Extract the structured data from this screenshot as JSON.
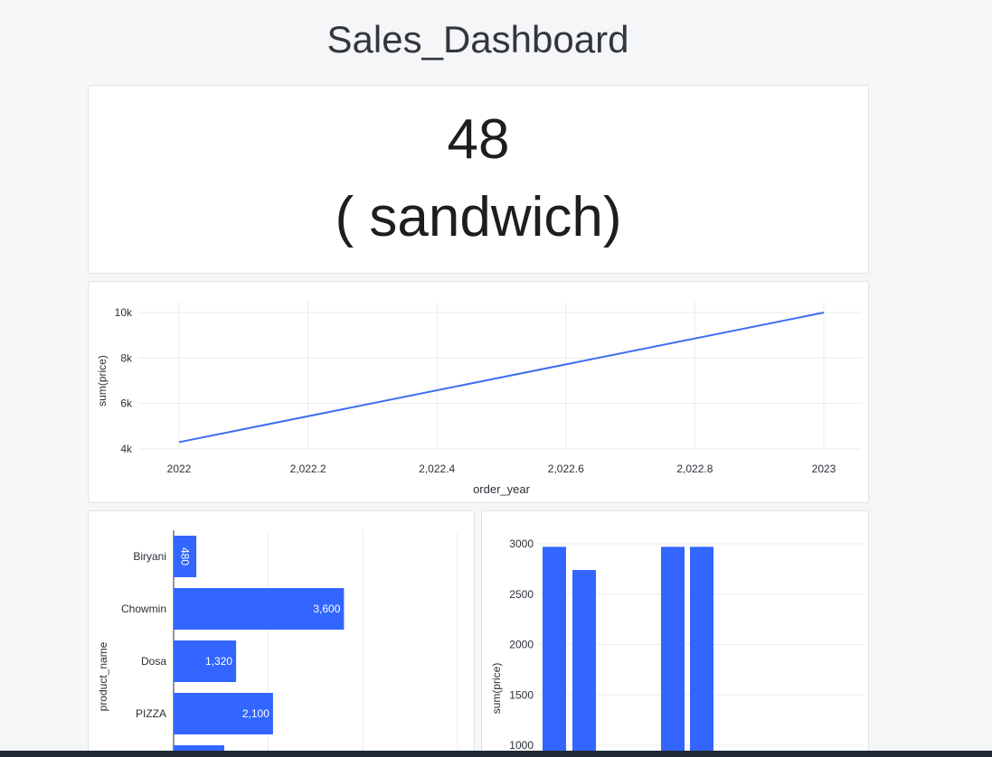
{
  "page": {
    "title": "Sales_Dashboard"
  },
  "kpi": {
    "value": "48",
    "label": "( sandwich)"
  },
  "colors": {
    "bar": "#3366ff",
    "line": "#3d6ef0",
    "grid": "#e9ebee",
    "axis_text": "#2a2f36"
  },
  "chart_data": [
    {
      "type": "line",
      "x": [
        2022,
        2023
      ],
      "y": [
        4300,
        10000
      ],
      "xlabel": "order_year",
      "ylabel": "sum(price)",
      "xticks": [
        "2022",
        "2,022.2",
        "2,022.4",
        "2,022.6",
        "2,022.8",
        "2023"
      ],
      "yticks": [
        "4k",
        "6k",
        "8k",
        "10k"
      ],
      "xlim": [
        2022,
        2023
      ],
      "ylim": [
        4000,
        10000
      ],
      "grid": true
    },
    {
      "type": "bar",
      "orientation": "horizontal",
      "categories": [
        "Biryani",
        "Chowmin",
        "Dosa",
        "PIZZA"
      ],
      "values": [
        480,
        3600,
        1320,
        2100
      ],
      "labels": [
        "480",
        "3,600",
        "1,320",
        "2,100"
      ],
      "ylabel": "product_name",
      "xlim": [
        0,
        6000
      ],
      "grid": true
    },
    {
      "type": "bar",
      "orientation": "vertical",
      "values": [
        2970,
        2740,
        2970,
        2970
      ],
      "ylabel": "sum(price)",
      "yticks": [
        "1000",
        "1500",
        "2000",
        "2500",
        "3000"
      ],
      "grid": true
    }
  ]
}
